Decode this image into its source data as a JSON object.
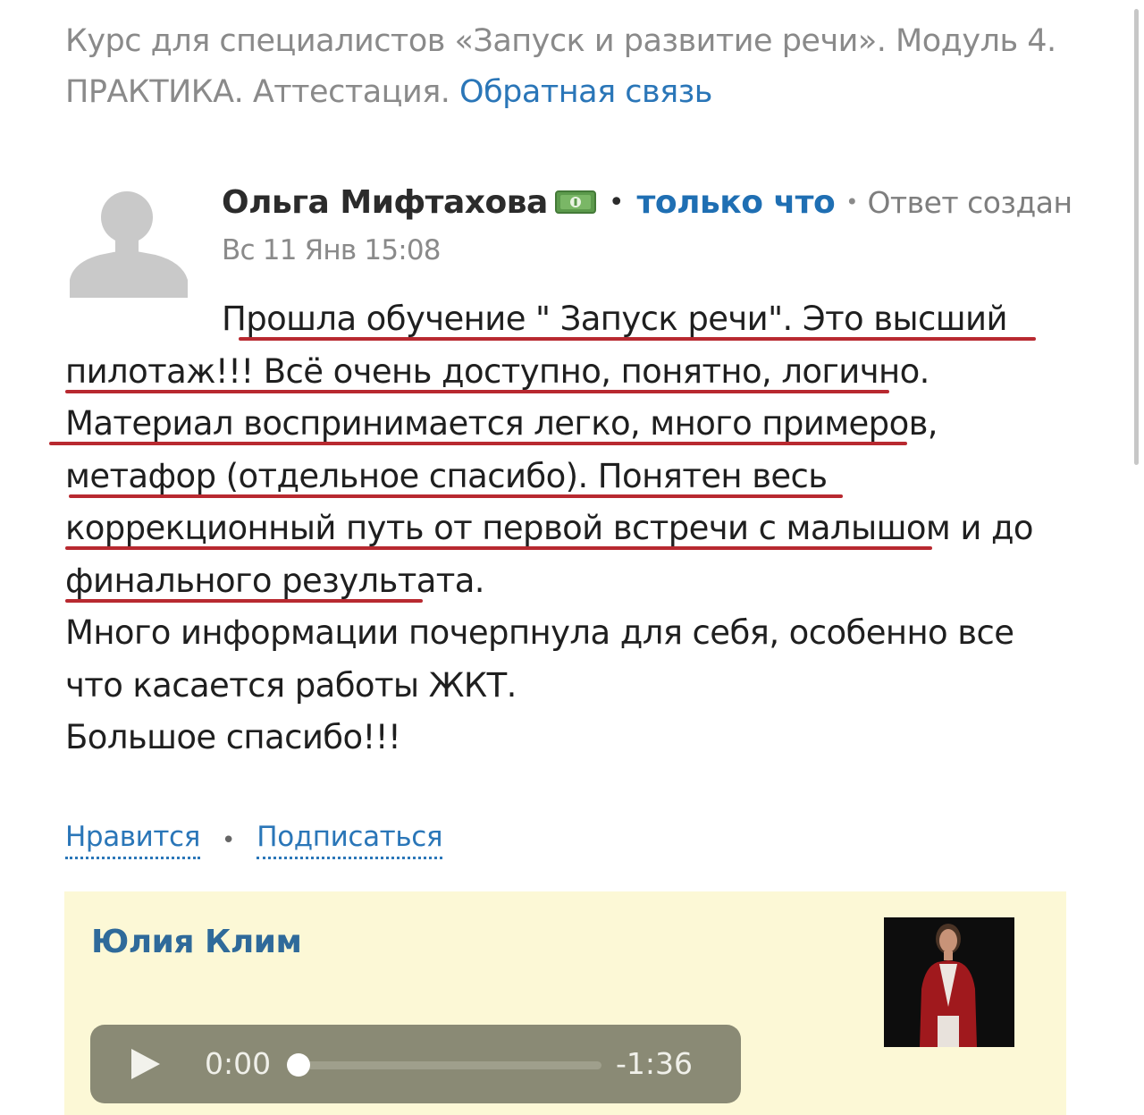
{
  "header": {
    "title_prefix": "Курс для специалистов «Запуск и развитие речи». Модуль 4. ПРАКТИКА. Аттестация.",
    "feedback_link": "Обратная связь"
  },
  "post": {
    "author": "Ольга Мифтахова",
    "separator": "•",
    "time_ago": "только что",
    "status": "Ответ создан",
    "date": "Вс 11 Янв 15:08",
    "body_lines": [
      "Прошла обучение \" Запуск речи\". Это высший",
      "пилотаж!!! Всё очень доступно, понятно, логично.",
      "Материал воспринимается легко, много примеров,",
      "метафор (отдельное спасибо). Понятен весь",
      "коррекционный путь от первой встречи с малышом и до",
      "финального результата.",
      "Много информации почерпнула для себя, особенно все",
      "что касается работы ЖКТ.",
      "Большое спасибо!!!"
    ],
    "icons": {
      "avatar": "user-silhouette-icon",
      "badge": "money-bill-icon"
    }
  },
  "actions": {
    "like": "Нравится",
    "subscribe": "Подписаться",
    "separator": "•"
  },
  "reply": {
    "author": "Юлия Клим",
    "audio": {
      "current_time": "0:00",
      "remaining_time": "-1:36",
      "progress": 0
    },
    "background_color": "#fcf8d6"
  },
  "colors": {
    "link": "#2a76b8",
    "underline": "#b0121a"
  }
}
